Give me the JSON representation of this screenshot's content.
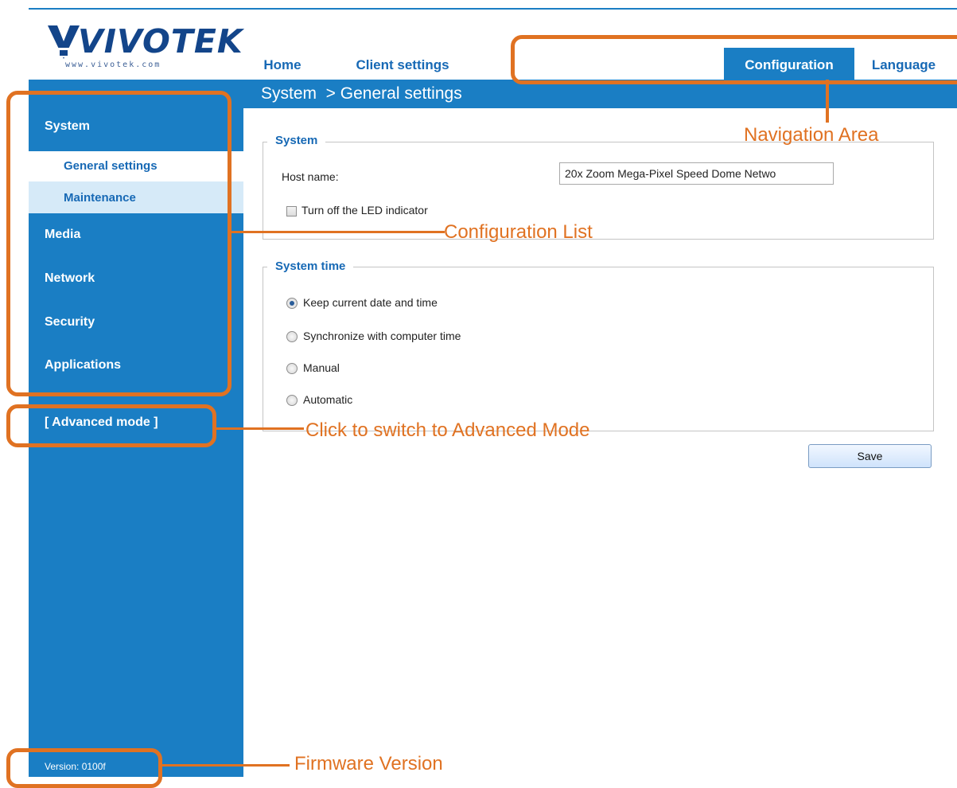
{
  "brand": {
    "name": "VIVOTEK",
    "url": "www.vivotek.com"
  },
  "nav": [
    {
      "label": "Home",
      "active": false
    },
    {
      "label": "Client settings",
      "active": false
    },
    {
      "label": "Configuration",
      "active": true
    },
    {
      "label": "Language",
      "active": false
    }
  ],
  "breadcrumb": "System  > General settings",
  "sidebar": {
    "system": "System",
    "subitems": [
      "General settings",
      "Maintenance"
    ],
    "media": "Media",
    "network": "Network",
    "security": "Security",
    "applications": "Applications",
    "advanced_mode": "[ Advanced mode ]",
    "version": "Version: 0100f"
  },
  "system_section": {
    "legend": "System",
    "host_label": "Host name:",
    "host_value": "20x Zoom Mega-Pixel Speed Dome Netwo",
    "led_label": "Turn off the LED indicator",
    "led_checked": false
  },
  "time_section": {
    "legend": "System time",
    "options": [
      {
        "label": "Keep current date and time",
        "checked": true
      },
      {
        "label": "Synchronize with computer time",
        "checked": false
      },
      {
        "label": "Manual",
        "checked": false
      },
      {
        "label": "Automatic",
        "checked": false
      }
    ]
  },
  "save_label": "Save",
  "annotations": {
    "navigation": "Navigation Area",
    "config_list": "Configuration List",
    "advanced": "Click to switch to Advanced Mode",
    "firmware": "Firmware Version"
  },
  "colors": {
    "accent": "#1a7ec4",
    "annotation": "#e07222",
    "link": "#1769b5"
  }
}
